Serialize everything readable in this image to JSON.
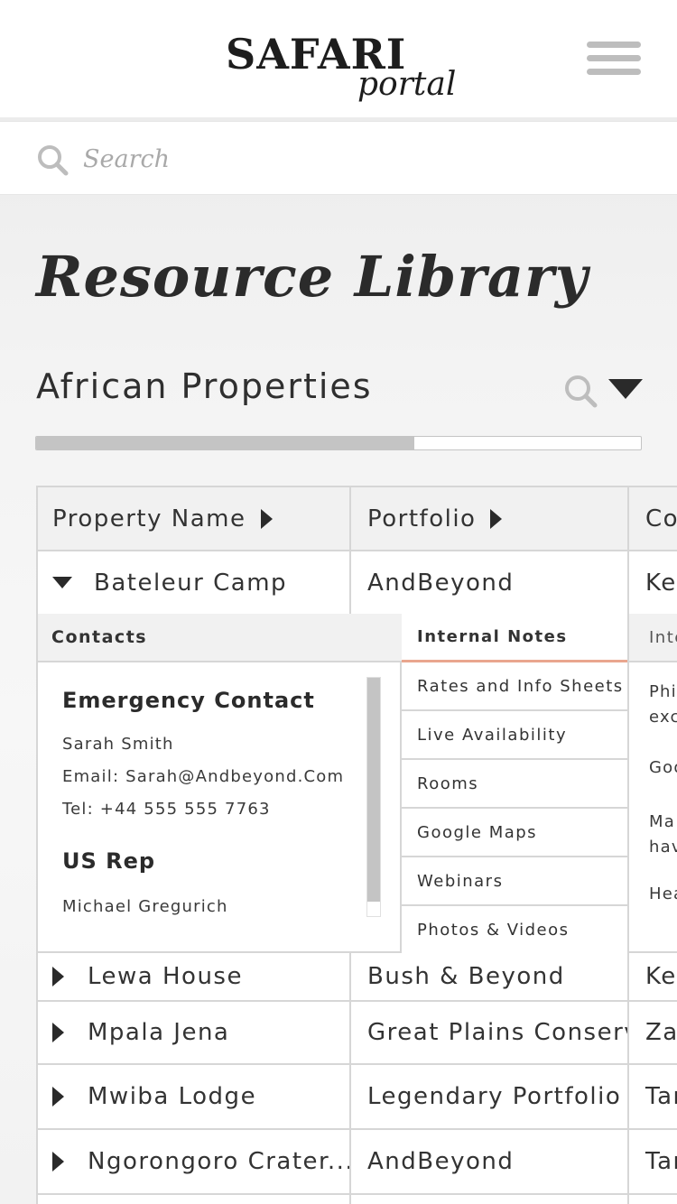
{
  "header": {
    "logo_main": "SAFARI",
    "logo_sub": "portal"
  },
  "search": {
    "placeholder": "Search"
  },
  "page": {
    "title": "Resource Library",
    "section_title": "African Properties",
    "progress_fraction": 0.625
  },
  "table": {
    "columns": [
      "Property Name",
      "Portfolio",
      "Co"
    ],
    "expanded_row": {
      "name": "Bateleur Camp",
      "portfolio": "AndBeyond",
      "country": "Ker"
    },
    "details": {
      "contacts_label": "Contacts",
      "emergency_heading": "Emergency Contact",
      "emergency_name": "Sarah Smith",
      "emergency_email": "Email: Sarah@Andbeyond.Com",
      "emergency_tel": "Tel: +44 555 555 7763",
      "rep_heading": "US Rep",
      "rep_name": "Michael Gregurich",
      "tabs": [
        "Internal Notes",
        "Rates and Info Sheets",
        "Live Availability",
        "Rooms",
        "Google Maps",
        "Webinars",
        "Photos & Videos"
      ],
      "active_tab": "Internal Notes",
      "notes_header": "Inte",
      "notes_lines": [
        "Phi",
        "exc",
        "Goo",
        "Ma",
        "hav",
        "Hea"
      ]
    },
    "rows": [
      {
        "name": "Lewa House",
        "portfolio": "Bush & Beyond",
        "country": "Ker"
      },
      {
        "name": "Mpala Jena",
        "portfolio": "Great Plains Conserv...",
        "country": "Zar"
      },
      {
        "name": "Mwiba Lodge",
        "portfolio": "Legendary Portfolio",
        "country": "Tan"
      },
      {
        "name": "Ngorongoro Crater...",
        "portfolio": "AndBeyond",
        "country": "Tan"
      }
    ]
  },
  "colors": {
    "accent_underline": "#e9a68e",
    "progress_fill": "#c4c4c4"
  }
}
